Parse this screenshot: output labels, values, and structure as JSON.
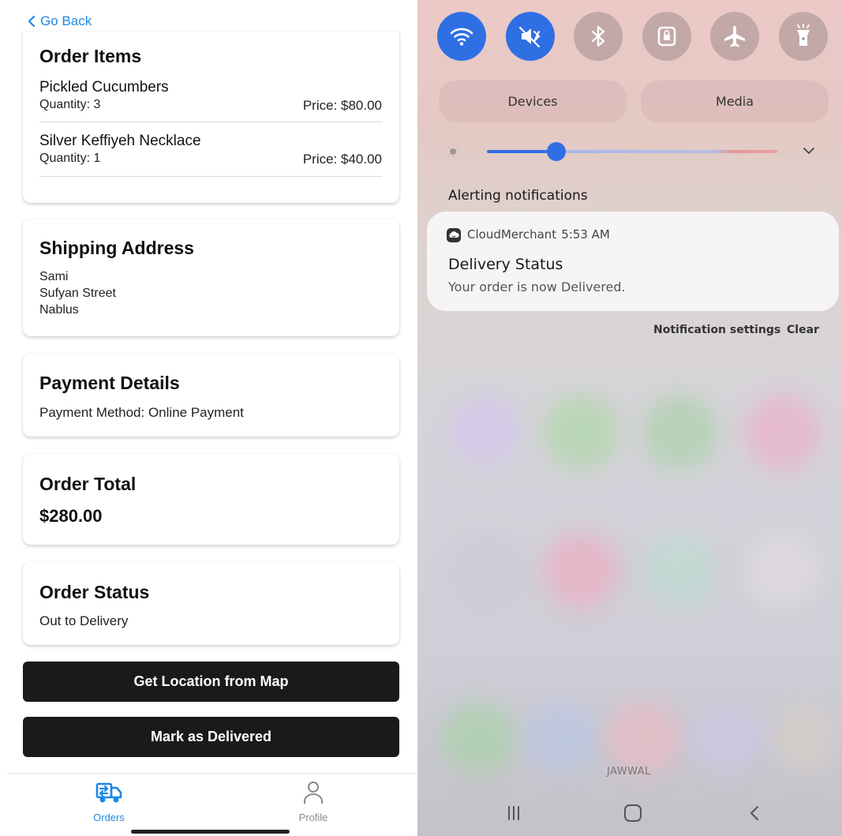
{
  "left": {
    "go_back": "Go Back",
    "order_items": {
      "title": "Order Items",
      "items": [
        {
          "name": "Pickled Cucumbers",
          "quantity": "Quantity: 3",
          "price": "Price: $80.00"
        },
        {
          "name": "Silver Keffiyeh Necklace",
          "quantity": "Quantity: 1",
          "price": "Price: $40.00"
        }
      ]
    },
    "shipping": {
      "title": "Shipping Address",
      "lines": [
        "Sami",
        "Sufyan Street",
        "Nablus"
      ]
    },
    "payment": {
      "title": "Payment Details",
      "method": "Payment Method: Online Payment"
    },
    "total": {
      "title": "Order Total",
      "amount": "$280.00"
    },
    "status": {
      "title": "Order Status",
      "value": "Out to Delivery"
    },
    "buttons": {
      "map": "Get Location from Map",
      "delivered": "Mark as Delivered"
    },
    "tabs": {
      "orders": "Orders",
      "profile": "Profile"
    },
    "colors": {
      "accent": "#1e88e5",
      "button": "#1a1a1a"
    }
  },
  "right": {
    "quick_settings": [
      {
        "icon": "wifi-icon",
        "on": true
      },
      {
        "icon": "mute-icon",
        "on": true
      },
      {
        "icon": "bluetooth-icon",
        "on": false
      },
      {
        "icon": "rotation-lock-icon",
        "on": false
      },
      {
        "icon": "airplane-icon",
        "on": false
      },
      {
        "icon": "flashlight-icon",
        "on": false
      }
    ],
    "devices": "Devices",
    "media": "Media",
    "brightness": 0.24,
    "alerting_header": "Alerting notifications",
    "notification": {
      "app": "CloudMerchant",
      "time": "5:53 AM",
      "title": "Delivery Status",
      "body": "Your order is now Delivered."
    },
    "notification_settings": "Notification settings",
    "clear": "Clear",
    "carrier": "JAWWAL",
    "colors": {
      "accent": "#2f6fe4"
    }
  }
}
